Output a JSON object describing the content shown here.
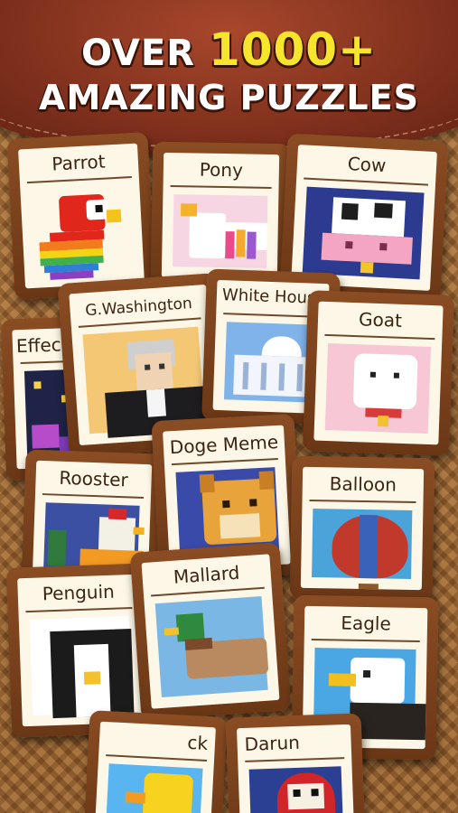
{
  "headline": {
    "line1_prefix": "OVER",
    "line1_number": "1000+",
    "line2": "AMAZING PUZZLES"
  },
  "puzzles": [
    {
      "id": "parrot",
      "title": "Parrot"
    },
    {
      "id": "pony",
      "title": "Pony"
    },
    {
      "id": "cow",
      "title": "Cow"
    },
    {
      "id": "effects",
      "title": "Effec"
    },
    {
      "id": "washington",
      "title": "G.Washington"
    },
    {
      "id": "whitehouse",
      "title": "White Hous"
    },
    {
      "id": "goat",
      "title": "Goat"
    },
    {
      "id": "doge",
      "title": "Doge Meme"
    },
    {
      "id": "rooster",
      "title": "Rooster"
    },
    {
      "id": "balloon",
      "title": "Balloon"
    },
    {
      "id": "penguin",
      "title": "Penguin"
    },
    {
      "id": "mallard",
      "title": "Mallard"
    },
    {
      "id": "eagle",
      "title": "Eagle"
    },
    {
      "id": "duck",
      "title": "ck"
    },
    {
      "id": "daruma",
      "title": "Darun"
    }
  ],
  "colors": {
    "banner": "#7d2f1c",
    "frame": "#7a4019",
    "paper": "#fdf7e7",
    "highlight": "#f7e52b"
  }
}
